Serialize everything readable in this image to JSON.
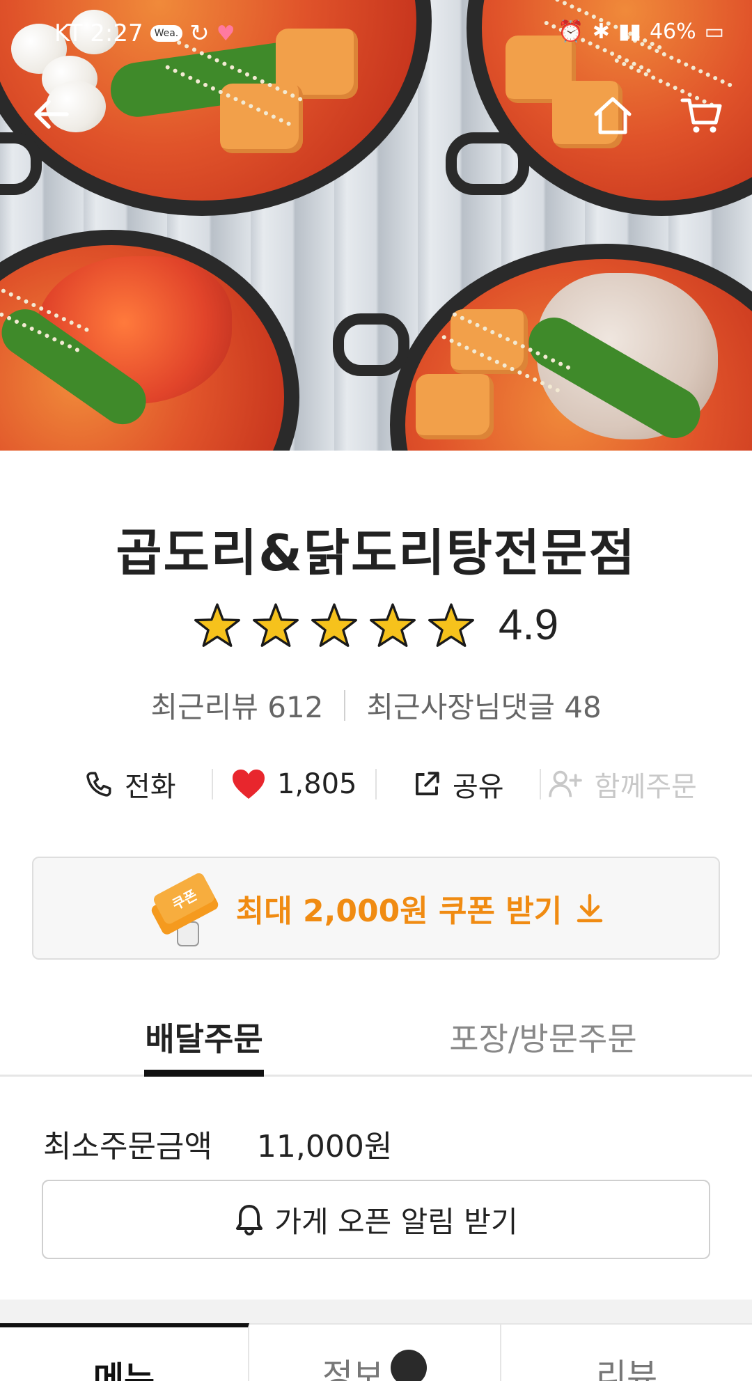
{
  "status_bar": {
    "carrier_time": "KT 2:27",
    "weather_chip": "Wea.",
    "battery": "46%"
  },
  "store": {
    "name": "곱도리&닭도리탕전문점",
    "rating": "4.9",
    "stars": 5,
    "recent_reviews_label": "최근리뷰 612",
    "owner_replies_label": "최근사장님댓글 48"
  },
  "actions": {
    "call": "전화",
    "likes": "1,805",
    "share": "공유",
    "group_order": "함께주문"
  },
  "coupon": {
    "ticket_label": "쿠폰",
    "text": "최대 2,000원 쿠폰 받기"
  },
  "order_tabs": {
    "delivery": "배달주문",
    "pickup": "포장/방문주문"
  },
  "min_order": {
    "label": "최소주문금액",
    "value": "11,000원"
  },
  "notify_button": "가게 오픈 알림 받기",
  "bottom_tabs": {
    "menu": "메뉴",
    "info": "정보",
    "review": "리뷰"
  },
  "colors": {
    "accent_orange": "#f08b12",
    "heart_red": "#e8262d",
    "star_gold": "#f6c21c"
  }
}
